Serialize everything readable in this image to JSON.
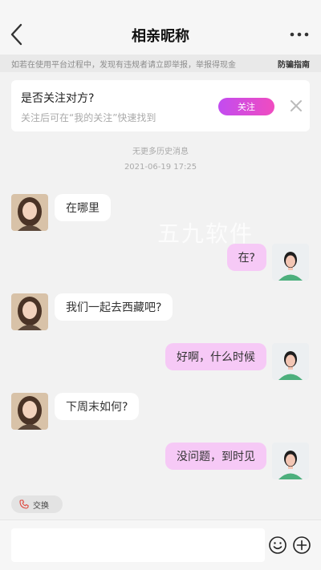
{
  "header": {
    "title": "相亲昵称",
    "back_icon": "chevron-left-icon",
    "more_icon": "more-horizontal-icon"
  },
  "warning": {
    "text": "如若在使用平台过程中，发现有违规者请立即举报，举报得现金",
    "link": "防骗指南"
  },
  "follow_card": {
    "question": "是否关注对方?",
    "hint": "关注后可在“我的关注”快速找到",
    "button_label": "关注",
    "close_icon": "close-icon"
  },
  "chat": {
    "no_more": "无更多历史消息",
    "timestamp": "2021-06-19 17:25",
    "watermark": "五九软件",
    "messages": [
      {
        "side": "left",
        "text": "在哪里"
      },
      {
        "side": "right",
        "text": "在?"
      },
      {
        "side": "left",
        "text": "我们一起去西藏吧?"
      },
      {
        "side": "right",
        "text": "好啊，什么时候"
      },
      {
        "side": "left",
        "text": "下周末如何?"
      },
      {
        "side": "right",
        "text": "没问题，到时见"
      }
    ]
  },
  "swap": {
    "label": "交换",
    "icon": "phone-icon"
  },
  "input": {
    "placeholder": "",
    "value": "",
    "emoji_icon": "smile-icon",
    "plus_icon": "plus-circle-icon"
  },
  "colors": {
    "accent_gradient_start": "#c24cf0",
    "accent_gradient_end": "#f04cc0",
    "bubble_mine": "#f6c9f6",
    "bubble_other": "#ffffff"
  }
}
